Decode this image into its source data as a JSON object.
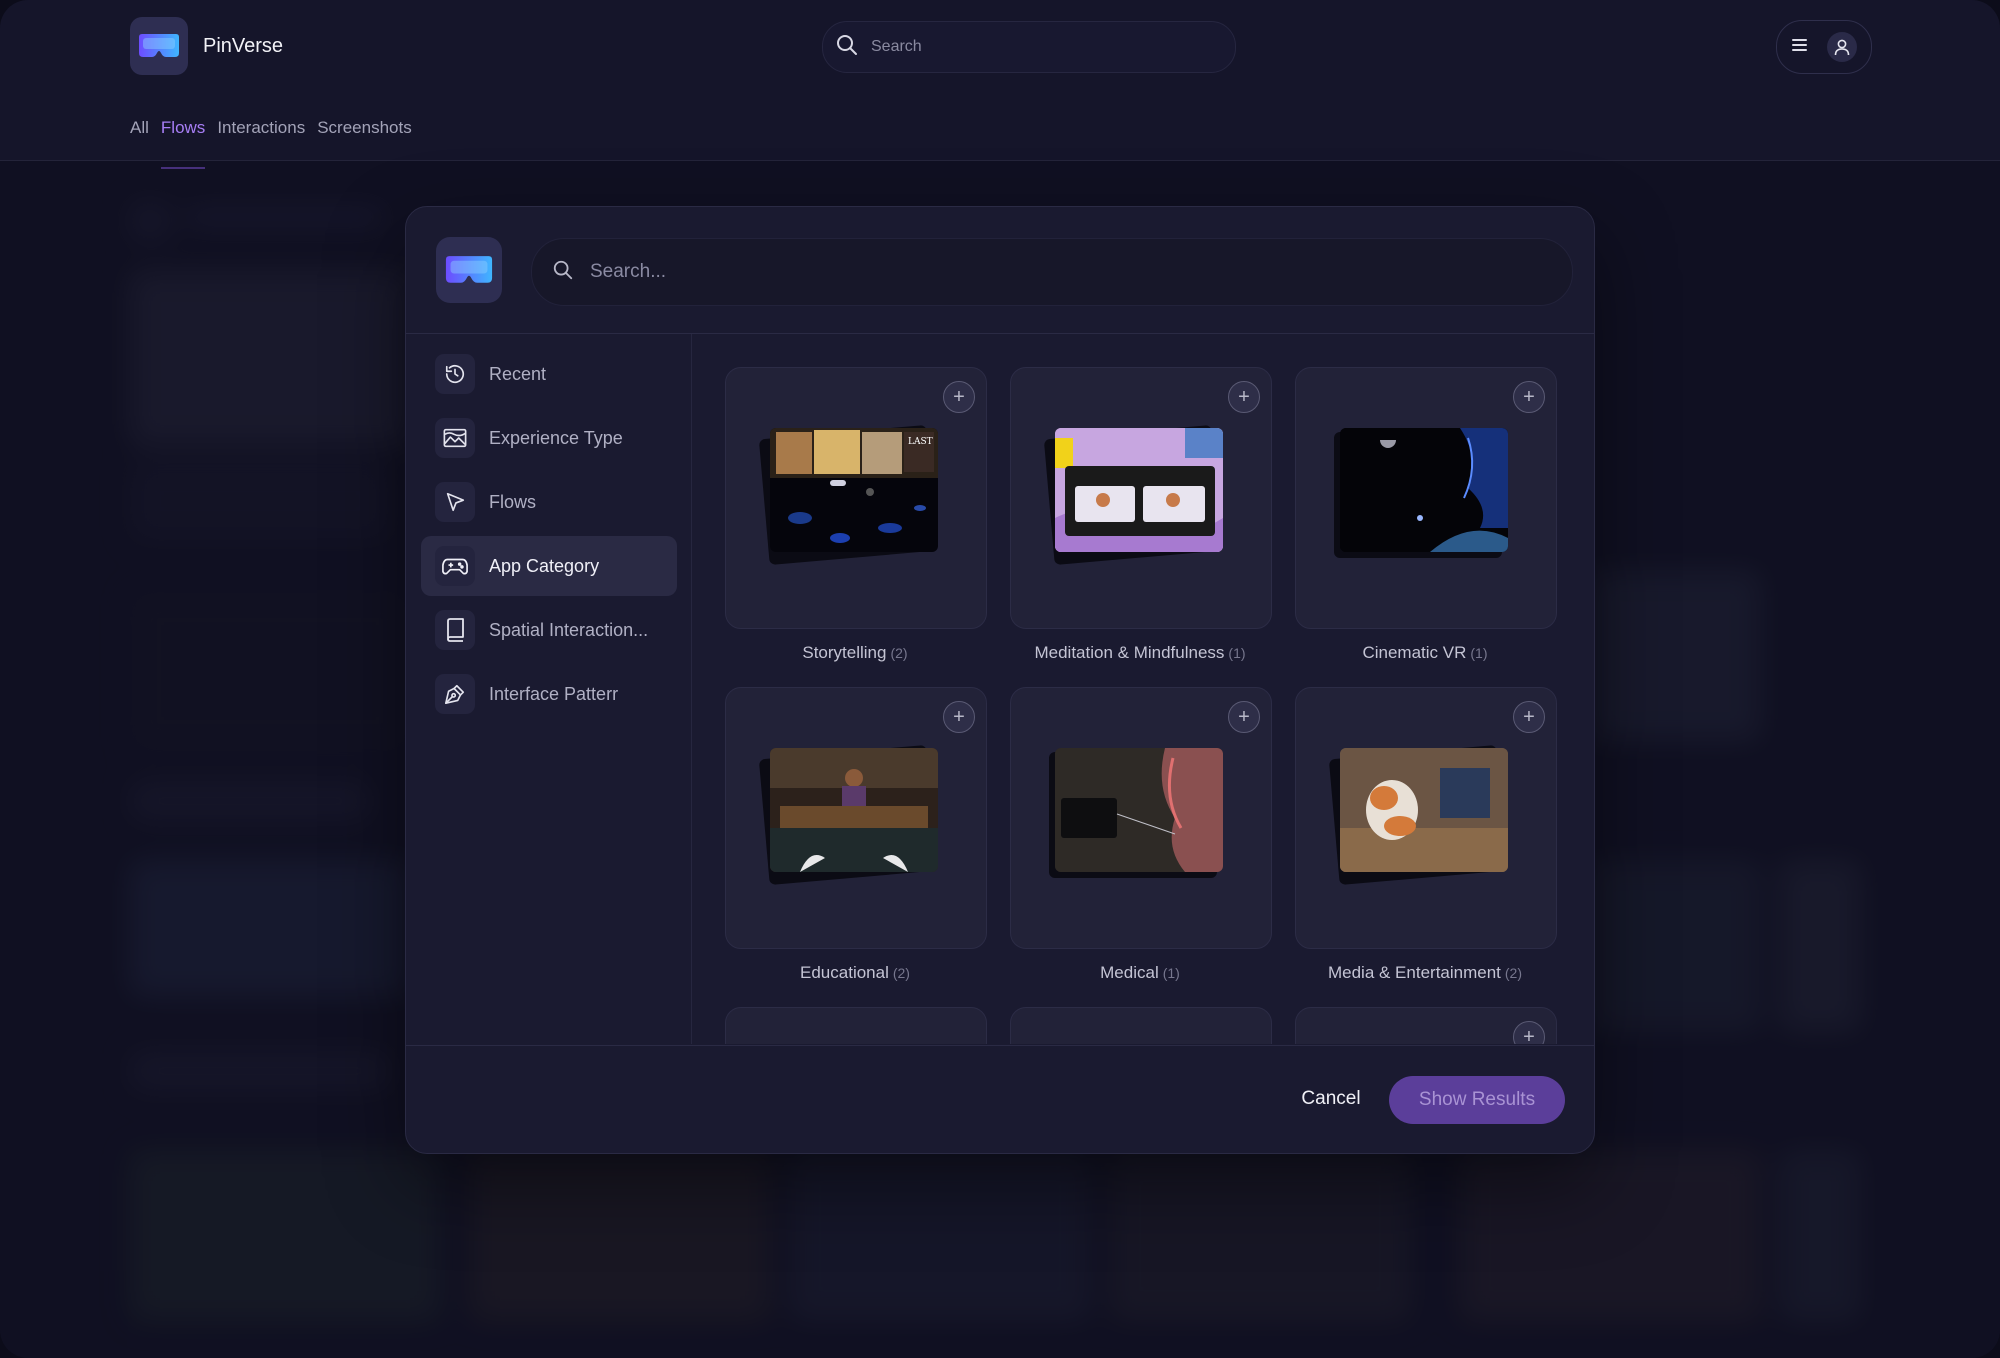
{
  "app": {
    "name": "PinVerse",
    "logo_icon": "vr-headset-icon"
  },
  "header": {
    "search_placeholder": "Search",
    "tabs": [
      {
        "label": "All",
        "active": false
      },
      {
        "label": "Flows",
        "active": true
      },
      {
        "label": "Interactions",
        "active": false
      },
      {
        "label": "Screenshots",
        "active": false
      }
    ],
    "menu_icon": "hamburger-menu-icon",
    "user_icon": "user-icon"
  },
  "modal": {
    "search_placeholder": "Search...",
    "sidebar": [
      {
        "label": "Recent",
        "icon": "history-icon",
        "active": false
      },
      {
        "label": "Experience Type",
        "icon": "landscape-image-icon",
        "active": false
      },
      {
        "label": "Flows",
        "icon": "cursor-pointer-icon",
        "active": false
      },
      {
        "label": "App Category",
        "icon": "gamepad-icon",
        "active": true
      },
      {
        "label": "Spatial Interaction...",
        "icon": "book-icon",
        "active": false
      },
      {
        "label": "Interface Patterr",
        "icon": "pen-tool-icon",
        "active": false
      }
    ],
    "categories": [
      {
        "label": "Storytelling",
        "count": "(2)"
      },
      {
        "label": "Meditation & Mindfulness",
        "count": "(1)"
      },
      {
        "label": "Cinematic VR",
        "count": "(1)"
      },
      {
        "label": "Educational",
        "count": "(2)"
      },
      {
        "label": "Medical",
        "count": "(1)"
      },
      {
        "label": "Media & Entertainment",
        "count": "(2)"
      }
    ],
    "thumbnail_text": {
      "last": "LAST"
    },
    "footer": {
      "cancel_label": "Cancel",
      "show_results_label": "Show Results"
    }
  },
  "colors": {
    "accent": "#8c5cf0",
    "primary_button": "#5b3e9a",
    "background": "#15152a",
    "modal": "#1a1a30"
  }
}
